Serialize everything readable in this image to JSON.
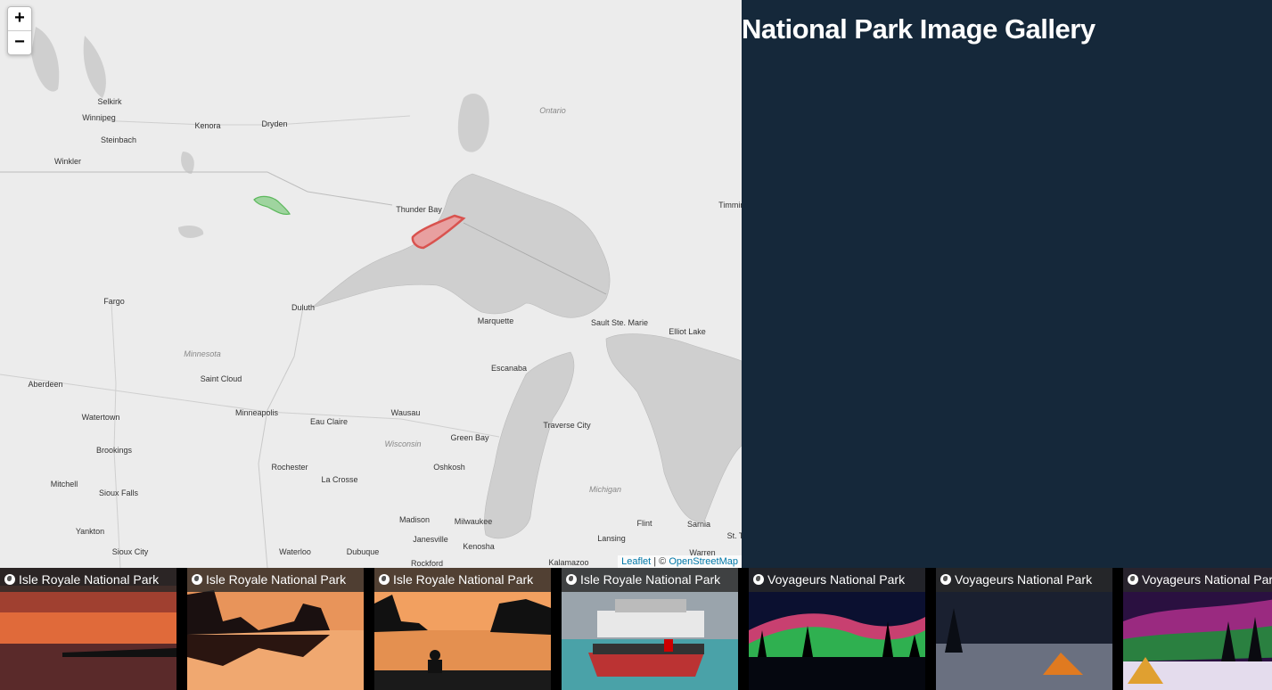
{
  "map": {
    "zoom_in": "+",
    "zoom_out": "−",
    "attribution_link1": "Leaflet",
    "attribution_sep": " | © ",
    "attribution_link2": "OpenStreetMap",
    "cities": [
      "Selkirk",
      "Winnipeg",
      "Steinbach",
      "Winkler",
      "Kenora",
      "Dryden",
      "Thunder Bay",
      "Timmins",
      "Fargo",
      "Duluth",
      "Marquette",
      "Sault Ste. Marie",
      "Elliot Lake",
      "Escanaba",
      "Aberdeen",
      "Saint Cloud",
      "Minneapolis",
      "Watertown",
      "Eau Claire",
      "Wausau",
      "Green Bay",
      "Traverse City",
      "Brookings",
      "Rochester",
      "Oshkosh",
      "La Crosse",
      "Mitchell",
      "Sioux Falls",
      "Madison",
      "Milwaukee",
      "Flint",
      "Sarnia",
      "Yankton",
      "Sioux City",
      "Waterloo",
      "Dubuque",
      "Janesville",
      "Kenosha",
      "Lansing",
      "Rockford",
      "Kalamazoo",
      "Warren",
      "St. T"
    ],
    "regions": [
      "Ontario",
      "Minnesota",
      "Wisconsin",
      "Michigan"
    ]
  },
  "gallery": {
    "title": "National Park Image Gallery",
    "thumbnails": [
      {
        "label": "Isle Royale National Park",
        "scene": "sunset"
      },
      {
        "label": "Isle Royale National Park",
        "scene": "orange-lake"
      },
      {
        "label": "Isle Royale National Park",
        "scene": "silhouette"
      },
      {
        "label": "Isle Royale National Park",
        "scene": "boat"
      },
      {
        "label": "Voyageurs National Park",
        "scene": "aurora"
      },
      {
        "label": "Voyageurs National Park",
        "scene": "tent-night"
      },
      {
        "label": "Voyageurs National Park",
        "scene": "aurora-tent"
      }
    ]
  },
  "colors": {
    "panel_bg": "#15283a",
    "park_green": "#5cb85c",
    "park_red": "#d9534f"
  }
}
